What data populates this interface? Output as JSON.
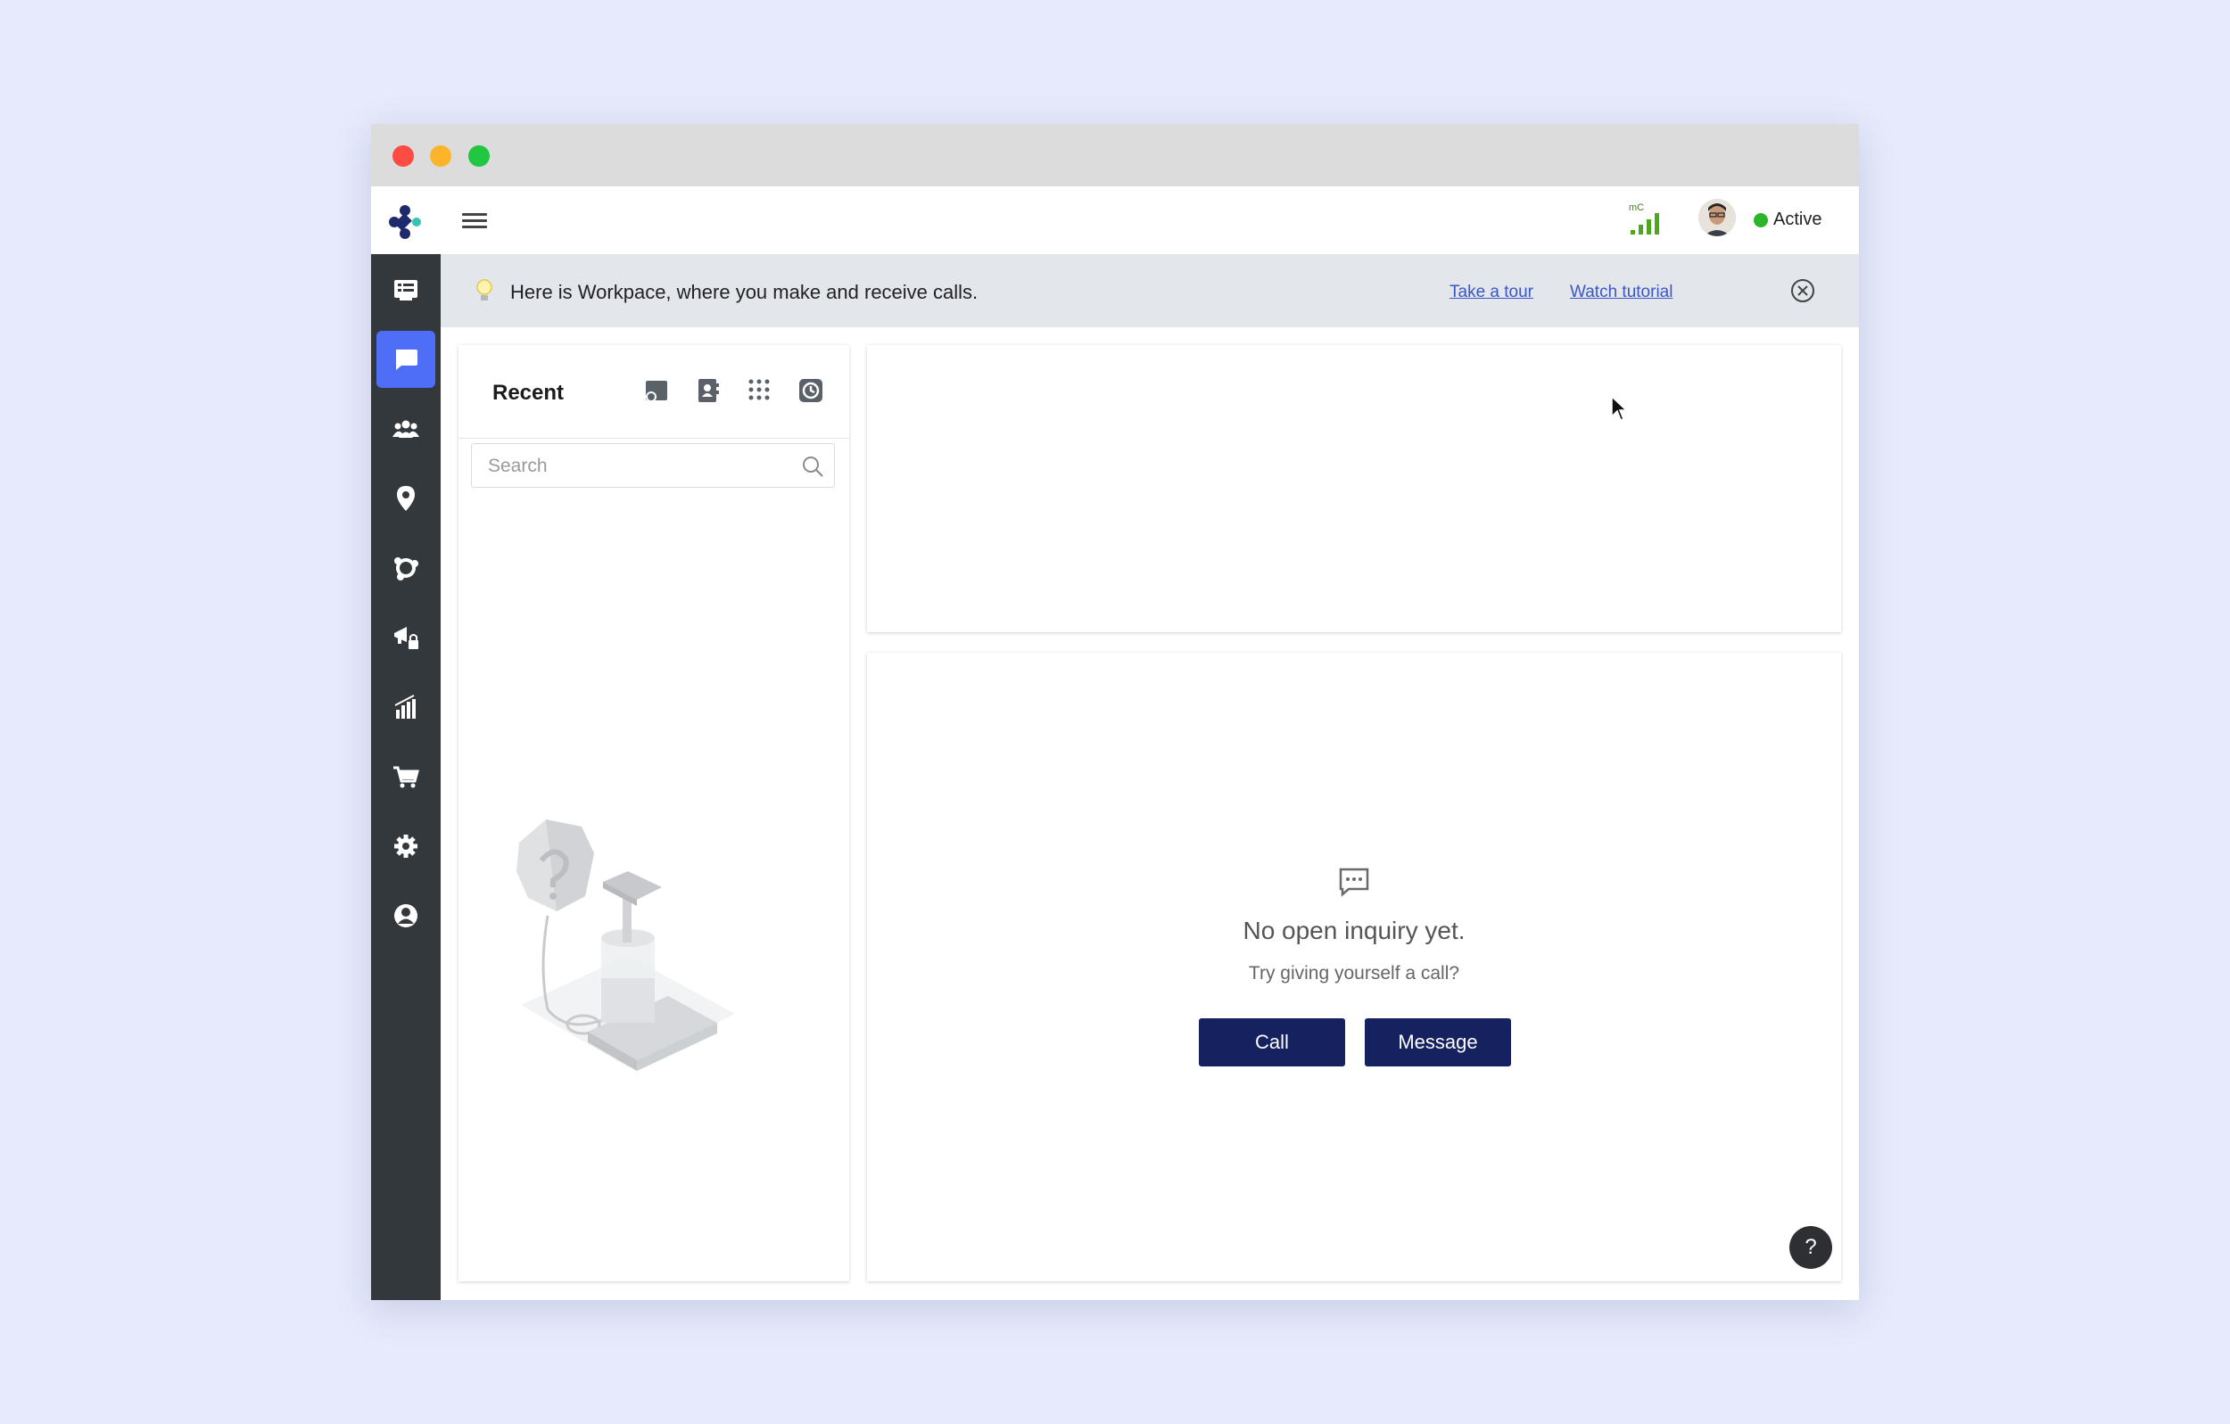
{
  "window": {
    "controls": [
      "close",
      "minimize",
      "maximize"
    ]
  },
  "topbar": {
    "signal_label": "mC",
    "status": "Active",
    "status_color": "#2bb52b"
  },
  "sidebar": {
    "items": [
      {
        "name": "dashboard",
        "icon": "dashboard-icon",
        "active": false
      },
      {
        "name": "workspace",
        "icon": "chat-bubble-icon",
        "active": true
      },
      {
        "name": "team",
        "icon": "team-icon",
        "active": false
      },
      {
        "name": "location",
        "icon": "location-pin-icon",
        "active": false
      },
      {
        "name": "integrations",
        "icon": "integrations-icon",
        "active": false
      },
      {
        "name": "campaigns",
        "icon": "megaphone-lock-icon",
        "active": false
      },
      {
        "name": "analytics",
        "icon": "analytics-icon",
        "active": false
      },
      {
        "name": "store",
        "icon": "cart-icon",
        "active": false
      },
      {
        "name": "settings",
        "icon": "gear-icon",
        "active": false
      },
      {
        "name": "account",
        "icon": "user-circle-icon",
        "active": false
      }
    ],
    "active_color": "#4f6ef7"
  },
  "banner": {
    "text": "Here is Workpace, where you make and receive calls.",
    "take_tour": "Take a tour",
    "watch_tutorial": "Watch tutorial"
  },
  "recent": {
    "title": "Recent",
    "tools": [
      "new-call-icon",
      "contacts-icon",
      "dialpad-icon",
      "history-icon"
    ],
    "search_placeholder": "Search"
  },
  "main": {
    "empty_title": "No open inquiry yet.",
    "empty_subtitle": "Try giving yourself a call?",
    "call_label": "Call",
    "message_label": "Message",
    "help_label": "?",
    "button_color": "#16215f"
  }
}
